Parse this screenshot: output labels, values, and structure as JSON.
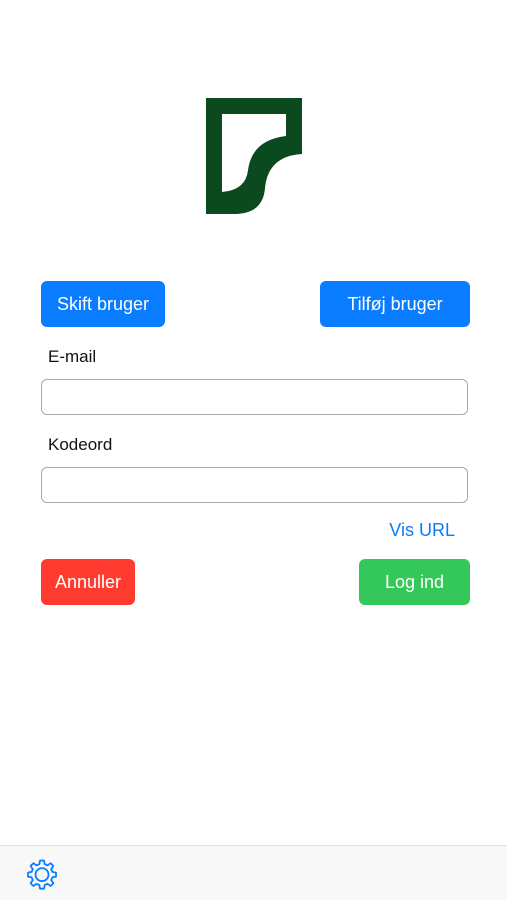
{
  "logo": {
    "icon": "brand-logo-icon",
    "color": "#0b4a1e"
  },
  "users": {
    "switch_label": "Skift bruger",
    "add_label": "Tilføj bruger"
  },
  "form": {
    "email_label": "E-mail",
    "email_value": "",
    "password_label": "Kodeord",
    "password_value": "",
    "show_url_label": "Vis URL"
  },
  "actions": {
    "cancel_label": "Annuller",
    "login_label": "Log ind"
  },
  "toolbar": {
    "settings_icon": "gear-icon"
  },
  "colors": {
    "accent": "#0a7cff",
    "cancel": "#ff3b30",
    "login": "#34c759",
    "brand": "#0b4a1e"
  }
}
